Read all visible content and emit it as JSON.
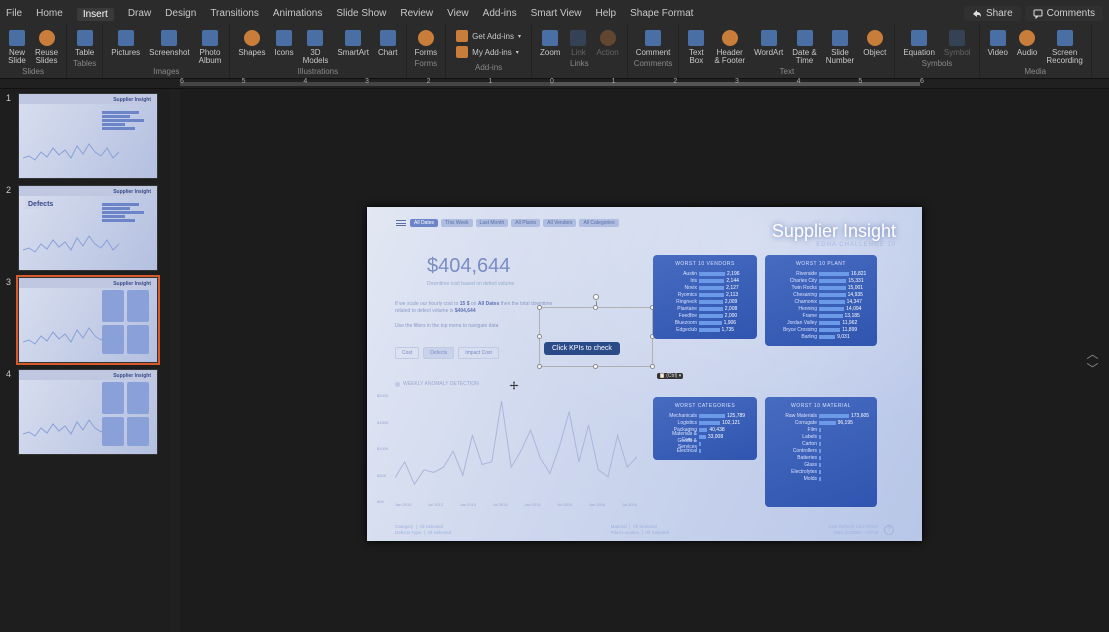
{
  "app": {
    "share": "Share",
    "comments": "Comments"
  },
  "menu": {
    "items": [
      "File",
      "Home",
      "Insert",
      "Draw",
      "Design",
      "Transitions",
      "Animations",
      "Slide Show",
      "Review",
      "View",
      "Add-ins",
      "Smart View",
      "Help",
      "Shape Format"
    ],
    "active": "Insert"
  },
  "ribbon": {
    "groups": [
      {
        "label": "Slides",
        "buttons": [
          {
            "l": "New\nSlide"
          },
          {
            "l": "Reuse\nSlides"
          }
        ]
      },
      {
        "label": "Tables",
        "buttons": [
          {
            "l": "Table"
          }
        ]
      },
      {
        "label": "Images",
        "buttons": [
          {
            "l": "Pictures"
          },
          {
            "l": "Screenshot"
          },
          {
            "l": "Photo\nAlbum"
          }
        ]
      },
      {
        "label": "Illustrations",
        "buttons": [
          {
            "l": "Shapes"
          },
          {
            "l": "Icons"
          },
          {
            "l": "3D\nModels"
          },
          {
            "l": "SmartArt"
          },
          {
            "l": "Chart"
          }
        ]
      },
      {
        "label": "Forms",
        "buttons": [
          {
            "l": "Forms"
          }
        ]
      },
      {
        "label": "Add-ins",
        "small": [
          {
            "l": "Get Add-ins"
          },
          {
            "l": "My Add-ins"
          }
        ]
      },
      {
        "label": "Links",
        "buttons": [
          {
            "l": "Zoom"
          },
          {
            "l": "Link",
            "dim": true
          },
          {
            "l": "Action",
            "dim": true
          }
        ]
      },
      {
        "label": "Comments",
        "buttons": [
          {
            "l": "Comment"
          }
        ]
      },
      {
        "label": "Text",
        "buttons": [
          {
            "l": "Text\nBox"
          },
          {
            "l": "Header\n& Footer"
          },
          {
            "l": "WordArt"
          },
          {
            "l": "Date &\nTime"
          },
          {
            "l": "Slide\nNumber"
          },
          {
            "l": "Object"
          }
        ]
      },
      {
        "label": "Symbols",
        "buttons": [
          {
            "l": "Equation"
          },
          {
            "l": "Symbol",
            "dim": true
          }
        ]
      },
      {
        "label": "Media",
        "buttons": [
          {
            "l": "Video"
          },
          {
            "l": "Audio"
          },
          {
            "l": "Screen\nRecording"
          }
        ]
      }
    ]
  },
  "ruler": {
    "labels": [
      "6",
      "5",
      "4",
      "3",
      "2",
      "1",
      "0",
      "1",
      "2",
      "3",
      "4",
      "5",
      "6"
    ]
  },
  "thumbs": {
    "count": 4,
    "selected": 3
  },
  "slide": {
    "brand_title": "Supplier Insight",
    "brand_sub": "EDNA CHALLENGE 10",
    "tabs": [
      "All Dates",
      "This Week",
      "Last Month",
      "All Plants",
      "All Vendors",
      "All Categories"
    ],
    "big_value": "$404,644",
    "big_sub": "Downtime cost based on defect volume",
    "blurb_html": "If we scale our hourly cost to 15 $ on All Dates then the total downtime related to defect volume is $404,644",
    "blurb_parts": {
      "p1": "If we scale our hourly cost to ",
      "b1": "15 $",
      "p2": " on ",
      "b2": "All Dates",
      "p3": " then the total downtime",
      "p4": "related to defect volume is ",
      "b3": "$404,644"
    },
    "filter_hint": "Use the filters in the top menu to navigate data",
    "pills": [
      "Cost",
      "Defects",
      "Impact Cost"
    ],
    "statline": "WEEKLY ANOMALY DETECTION",
    "callout": "Click KPIs to check",
    "ctrl_hint": "(Ctrl) ▾",
    "footer": {
      "l1": "Category",
      "l1v": "All Selected",
      "l2": "Defects Type",
      "l2v": "All Selected",
      "m1": "Material",
      "m1v": "All Selected",
      "m2": "Plant Location",
      "m2v": "All Selected",
      "r1": "Last Refresh 12/17/2020",
      "r2": "Date 1/1/2004 – 10/18"
    },
    "panels": {
      "vendors": {
        "title": "WORST 10 VENDORS",
        "rows": [
          {
            "n": "Austin",
            "v": "2,196"
          },
          {
            "n": "Iris",
            "v": "2,144"
          },
          {
            "n": "Novix",
            "v": "2,127"
          },
          {
            "n": "Ryomics",
            "v": "2,113"
          },
          {
            "n": "Ringneck",
            "v": "2,009"
          },
          {
            "n": "Plantaire",
            "v": "2,008"
          },
          {
            "n": "Feedfire",
            "v": "2,000"
          },
          {
            "n": "Bluezoom",
            "v": "1,906"
          },
          {
            "n": "Edgeclub",
            "v": "1,735"
          }
        ]
      },
      "plants": {
        "title": "WORST 10 PLANT",
        "rows": [
          {
            "n": "Riverside",
            "v": "16,821"
          },
          {
            "n": "Charles City",
            "v": "15,331"
          },
          {
            "n": "Twin Rocks",
            "v": "15,001"
          },
          {
            "n": "Chesaning",
            "v": "14,935"
          },
          {
            "n": "Chamonix",
            "v": "14,347"
          },
          {
            "n": "Henning",
            "v": "14,094"
          },
          {
            "n": "Frame",
            "v": "13,185"
          },
          {
            "n": "Jordan Valley",
            "v": "11,962"
          },
          {
            "n": "Bryce Crossing",
            "v": "11,899"
          },
          {
            "n": "Barling",
            "v": "9,031"
          }
        ]
      },
      "categories": {
        "title": "WORST CATEGORIES",
        "rows": [
          {
            "n": "Mechanicals",
            "v": "125,789"
          },
          {
            "n": "Logistics",
            "v": "102,121"
          },
          {
            "n": "Packaging",
            "v": "40,438"
          },
          {
            "n": "Materials & Com…",
            "v": "33,008"
          },
          {
            "n": "Goods & Services",
            "v": ""
          },
          {
            "n": "Electrical",
            "v": ""
          }
        ]
      },
      "materials": {
        "title": "WORST 10 MATERIAL",
        "rows": [
          {
            "n": "Raw Materials",
            "v": "173,605"
          },
          {
            "n": "Corrugate",
            "v": "96,195"
          },
          {
            "n": "Film",
            "v": ""
          },
          {
            "n": "Labels",
            "v": ""
          },
          {
            "n": "Carton",
            "v": ""
          },
          {
            "n": "Controllers",
            "v": ""
          },
          {
            "n": "Batteries",
            "v": ""
          },
          {
            "n": "Glass",
            "v": ""
          },
          {
            "n": "Electrolytes",
            "v": ""
          },
          {
            "n": "Molds",
            "v": ""
          }
        ]
      }
    }
  },
  "chart_data": {
    "type": "line",
    "title": "Weekly anomaly detection",
    "x": [
      "Jan 2013",
      "Jul 2013",
      "Jan 2014",
      "Jul 2014",
      "Jan 2015",
      "Jul 2015",
      "Jan 2016",
      "Jul 2016"
    ],
    "xlabel": "",
    "ylabel": "",
    "y_ticks": [
      "$200K",
      "$150K",
      "$100K",
      "$50K",
      "$0K"
    ],
    "ylim": [
      0,
      200
    ],
    "series": [
      {
        "name": "cost",
        "values": [
          40,
          70,
          28,
          55,
          50,
          60,
          90,
          45,
          120,
          65,
          70,
          185,
          60,
          90,
          130,
          78,
          48,
          100,
          165,
          70,
          140,
          55,
          42,
          120,
          60,
          80
        ]
      }
    ]
  }
}
